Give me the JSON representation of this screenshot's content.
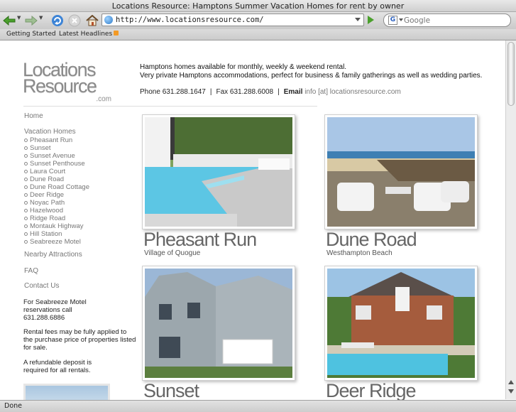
{
  "window": {
    "title": "Locations Resource: Hamptons Summer Vacation Homes for rent by owner",
    "url": "http://www.locationsresource.com/",
    "search_placeholder": "Google",
    "status": "Done"
  },
  "bookmarks": {
    "items": [
      "Getting Started",
      "Latest Headlines"
    ]
  },
  "icons": {
    "back": "back-arrow-icon",
    "forward": "forward-arrow-icon",
    "reload": "reload-icon",
    "stop": "stop-icon",
    "home": "home-icon",
    "site": "globe-icon",
    "go": "go-arrow-icon",
    "search_engine": "google-icon",
    "feed": "rss-icon"
  },
  "logo": {
    "line1": "Locations",
    "line2": "Resource",
    "suffix": ".com"
  },
  "intro": {
    "line1": "Hamptons homes available for monthly, weekly & weekend rental.",
    "line2": "Very private Hamptons accommodations, perfect for business & family gatherings as well as wedding parties."
  },
  "contact": {
    "phone": "Phone 631.288.1647",
    "fax": "Fax 631.288.6008",
    "email_label": "Email",
    "email_value": "info [at] locationsresource.com"
  },
  "nav": {
    "home": "Home",
    "vacation_homes": "Vacation Homes",
    "properties": [
      "Pheasant Run",
      "Sunset",
      "Sunset Avenue",
      "Sunset Penthouse",
      "Laura Court",
      "Dune Road",
      "Dune Road Cottage",
      "Deer Ridge",
      "Noyac Path",
      "Hazelwood",
      "Ridge Road",
      "Montauk Highway",
      "Hill Station",
      "Seabreeze Motel"
    ],
    "nearby": "Nearby Attractions",
    "faq": "FAQ",
    "contact": "Contact Us"
  },
  "side_info": {
    "seabreeze": "For Seabreeze Motel reservations call 631.288.6886",
    "fees": "Rental fees may be fully applied to the purchase price of properties listed for sale.",
    "deposit": "A refundable deposit is required for all rentals."
  },
  "listings": [
    {
      "name": "Pheasant Run",
      "location": "Village of Quogue"
    },
    {
      "name": "Dune Road",
      "location": "Westhampton Beach"
    },
    {
      "name": "Sunset",
      "location": ""
    },
    {
      "name": "Deer Ridge",
      "location": ""
    }
  ]
}
